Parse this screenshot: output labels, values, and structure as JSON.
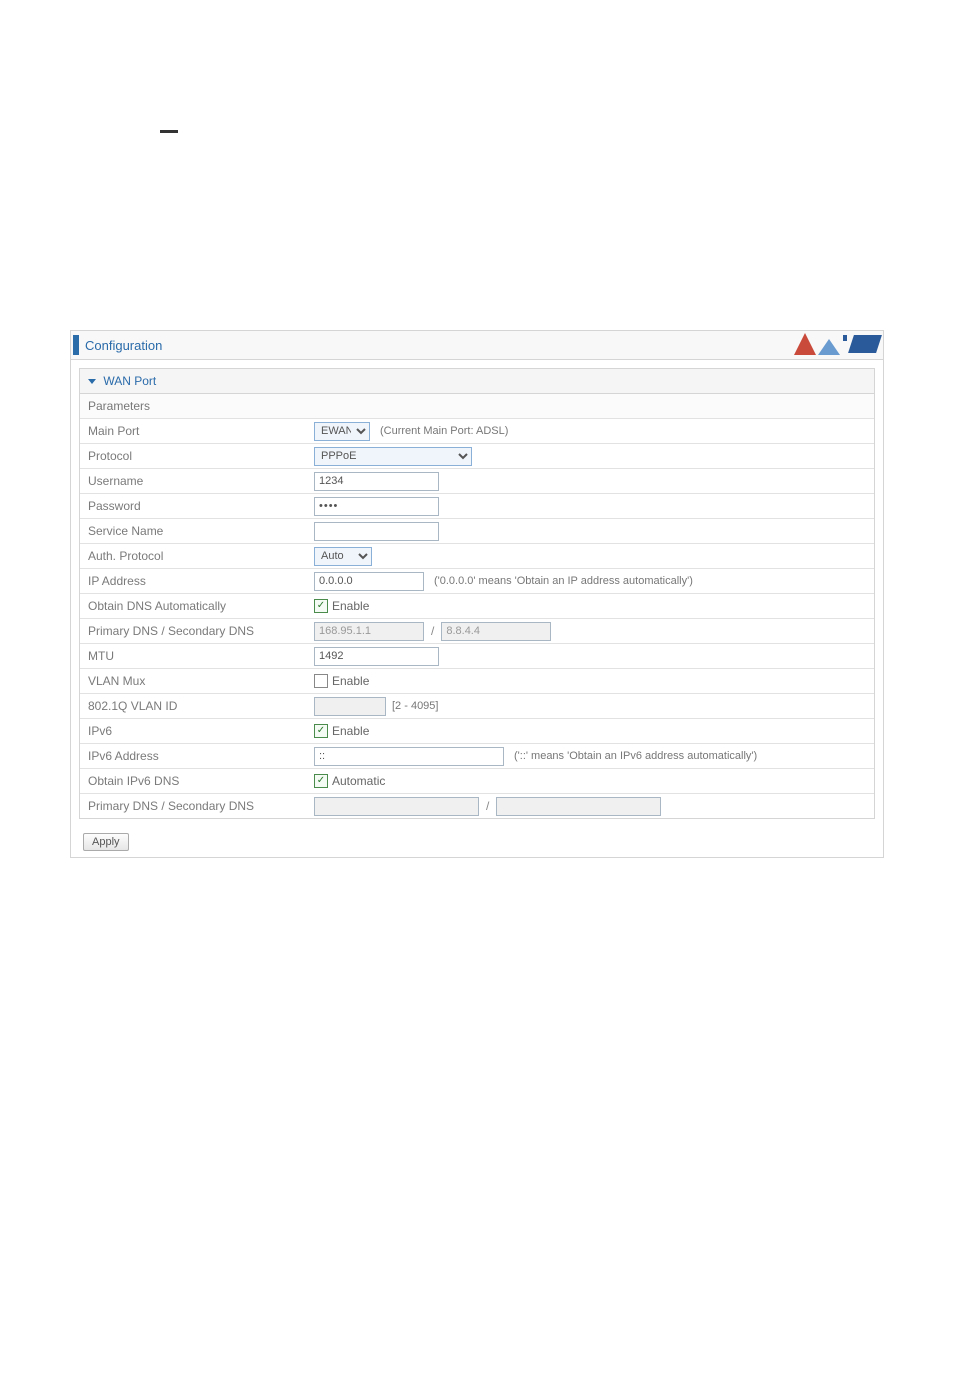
{
  "header": {
    "title": "Configuration"
  },
  "section": {
    "title": "WAN Port",
    "parameters_label": "Parameters"
  },
  "rows": {
    "main_port": {
      "label": "Main Port",
      "select_value": "EWAN",
      "hint": "(Current Main Port: ADSL)"
    },
    "protocol": {
      "label": "Protocol",
      "select_value": "PPPoE"
    },
    "username": {
      "label": "Username",
      "value": "1234"
    },
    "password": {
      "label": "Password",
      "value": "••••"
    },
    "service_name": {
      "label": "Service Name",
      "value": ""
    },
    "auth_protocol": {
      "label": "Auth. Protocol",
      "select_value": "Auto"
    },
    "ip_address": {
      "label": "IP Address",
      "value": "0.0.0.0",
      "hint": "('0.0.0.0' means 'Obtain an IP address automatically')"
    },
    "obtain_dns": {
      "label": "Obtain DNS Automatically",
      "cb_label": "Enable",
      "checked": true
    },
    "dns": {
      "label": "Primary DNS / Secondary DNS",
      "primary": "168.95.1.1",
      "secondary": "8.8.4.4"
    },
    "mtu": {
      "label": "MTU",
      "value": "1492"
    },
    "vlan_mux": {
      "label": "VLAN Mux",
      "cb_label": "Enable",
      "checked": false
    },
    "vlan_id": {
      "label": "802.1Q VLAN ID",
      "value": "",
      "hint": "[2 - 4095]"
    },
    "ipv6": {
      "label": "IPv6",
      "cb_label": "Enable",
      "checked": true
    },
    "ipv6_address": {
      "label": "IPv6 Address",
      "value": "::",
      "hint": "('::' means 'Obtain an IPv6 address automatically')"
    },
    "obtain_ipv6_dns": {
      "label": "Obtain IPv6 DNS",
      "cb_label": "Automatic",
      "checked": true
    },
    "ipv6_dns": {
      "label": "Primary DNS / Secondary DNS",
      "primary": "",
      "secondary": ""
    }
  },
  "buttons": {
    "apply": "Apply"
  }
}
